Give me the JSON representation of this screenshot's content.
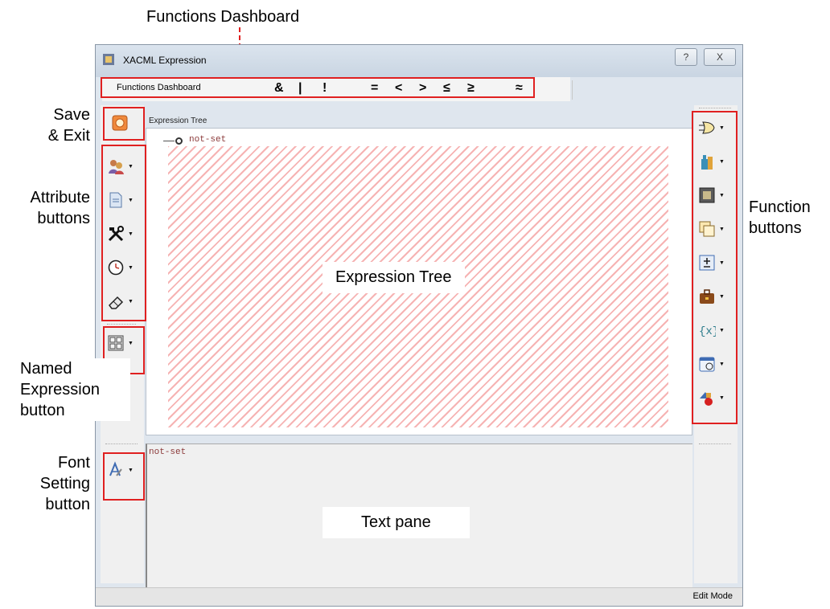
{
  "callouts": {
    "functions_dashboard": "Functions Dashboard",
    "save_exit": [
      "Save",
      "& Exit"
    ],
    "attribute_buttons": [
      "Attribute",
      "buttons"
    ],
    "named_expression": [
      "Named",
      "Expression",
      "button"
    ],
    "font_setting": [
      "Font",
      "Setting",
      "button"
    ],
    "function_buttons": [
      "Function",
      "buttons"
    ]
  },
  "window": {
    "title": "XACML Expression",
    "help_button": "?",
    "close_button": "X"
  },
  "dashboard": {
    "label": "Functions Dashboard",
    "operators": [
      "&",
      "|",
      "!",
      "=",
      "<",
      ">",
      "≤",
      "≥",
      "≈"
    ]
  },
  "expression_tree": {
    "header": "Expression Tree",
    "node": "not-set",
    "overlay_label": "Expression Tree"
  },
  "text_pane": {
    "content": "not-set",
    "overlay_label": "Text pane"
  },
  "status": {
    "mode": "Edit Mode"
  },
  "icons": {
    "save": "save-exit-icon",
    "attributes": [
      "users-icon",
      "document-icon",
      "tools-icon",
      "clock-icon",
      "eraser-icon"
    ],
    "named_expression": "named-expression-icon",
    "font": "font-setting-icon",
    "functions": [
      "logic-gate-icon",
      "bottle-icon",
      "math-box-icon",
      "copy-icon",
      "plus-minus-icon",
      "briefcase-icon",
      "variable-icon",
      "calendar-icon",
      "shapes-icon"
    ]
  },
  "colors": {
    "highlight": "#e02020",
    "hatch": "#f6b3b3"
  }
}
